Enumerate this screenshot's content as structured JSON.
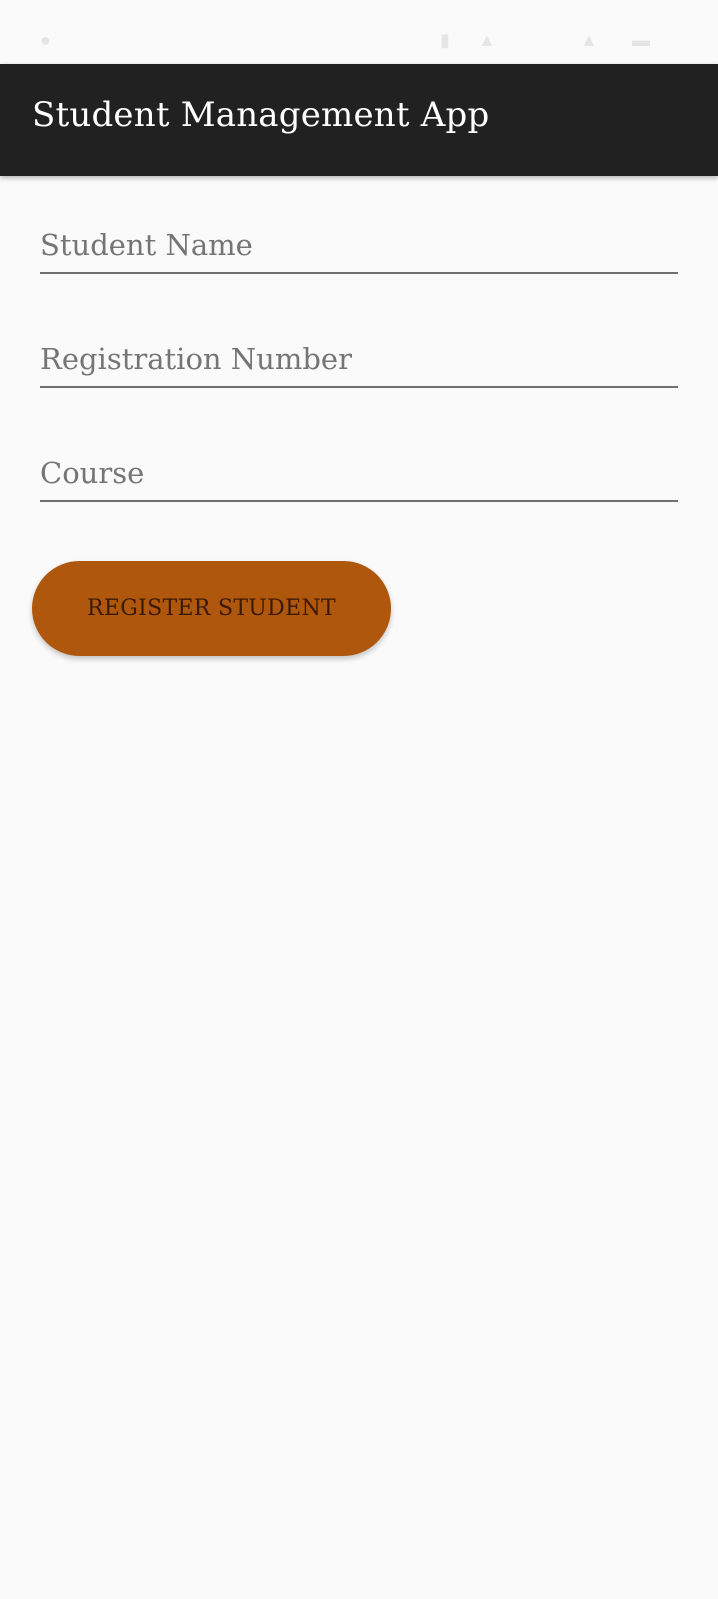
{
  "app_bar": {
    "title": "Student Management App"
  },
  "form": {
    "student_name_placeholder": "Student Name",
    "student_name_value": "",
    "registration_number_placeholder": "Registration Number",
    "registration_number_value": "",
    "course_placeholder": "Course",
    "course_value": "",
    "register_button_label": "REGISTER STUDENT"
  },
  "colors": {
    "app_bar_background": "#212121",
    "page_background": "#fafafa",
    "button_background": "#b0570e",
    "button_text": "#3a1a06"
  }
}
